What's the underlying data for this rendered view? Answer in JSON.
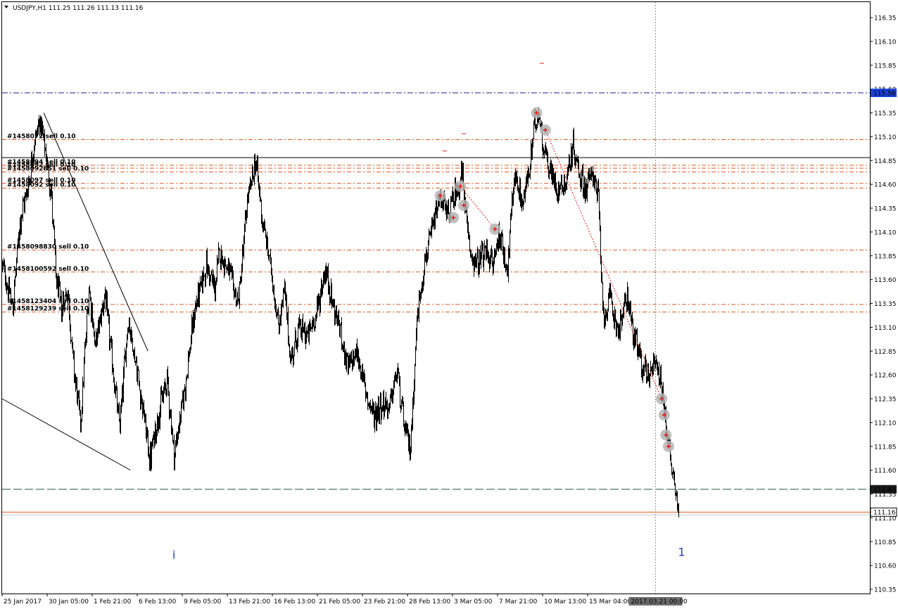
{
  "window": {
    "title": "USDJPY,H1  111.25 111.26 111.13 111.16",
    "menu_icon": "triangle-down-icon"
  },
  "colors": {
    "background": "#ffffff",
    "candles": "#000000",
    "order_line": "#e0561b",
    "resistance_line": "#1b1b8c",
    "support_line": "#1f5e3a",
    "bid_line": "#e0561b",
    "price_tag_blue": "#1a3fd6",
    "price_tag_dark": "#1a1a1a",
    "wave_label": "#1a3fd6",
    "marker_circle": "#b4b4b4",
    "trade_connect": "#e01b1b"
  },
  "chart_data": {
    "type": "candlestick",
    "symbol": "USDJPY",
    "timeframe": "H1",
    "ohlc_header": {
      "open": 111.25,
      "high": 111.26,
      "low": 111.13,
      "close": 111.16
    },
    "ylim": [
      110.3,
      116.45
    ],
    "y_ticks": [
      "116.35",
      "116.10",
      "115.85",
      "115.60",
      "115.35",
      "115.10",
      "114.85",
      "114.60",
      "114.35",
      "114.10",
      "113.85",
      "113.60",
      "113.35",
      "113.10",
      "112.85",
      "112.60",
      "112.35",
      "112.10",
      "111.85",
      "111.60",
      "111.35",
      "111.10",
      "110.85",
      "110.60",
      "110.35"
    ],
    "x_ticks": [
      "25 Jan 2017",
      "30 Jan 05:00",
      "1 Feb 21:00",
      "6 Feb 13:00",
      "9 Feb 05:00",
      "13 Feb 21:00",
      "16 Feb 13:00",
      "21 Feb 05:00",
      "23 Feb 21:00",
      "28 Feb 13:00",
      "3 Mar 05:00",
      "7 Mar 21:00",
      "10 Mar 13:00",
      "15 Mar 04:00"
    ],
    "cursor_time_label": "2017.03.21 00:00",
    "highlight_prices": [
      {
        "label": "115.56",
        "value": 115.56,
        "style": "resistance"
      },
      {
        "label": "111.40",
        "value": 111.4,
        "style": "support"
      },
      {
        "label": "111.16",
        "value": 111.16,
        "style": "bid"
      }
    ],
    "horizontal_line": 114.88,
    "orders": [
      {
        "label": "#145807",
        "suffix": "sell 0.10",
        "price": 115.07
      },
      {
        "label": "#14580",
        "suffix": "sell 0.10",
        "price": 114.8
      },
      {
        "label": "#145809",
        "suffix": "sell 0.10",
        "price": 114.77
      },
      {
        "label": "#145809",
        "suffix": "sell 0.10",
        "price": 114.73
      },
      {
        "label": "#14580",
        "suffix": "sell 0.10",
        "price": 114.61
      },
      {
        "label": "#145809",
        "suffix": "sell 0.10",
        "price": 114.56
      },
      {
        "label": "#145809",
        "suffix": "sell 0.10",
        "price": 113.91
      },
      {
        "label": "#145810",
        "suffix": "sell 0.10",
        "price": 113.68
      },
      {
        "label": "#145812",
        "suffix": "sell 0.10",
        "price": 113.34
      },
      {
        "label": "#145812",
        "suffix": "sell 0.10",
        "price": 113.26
      }
    ],
    "order_labels": [
      {
        "text": "#1458072",
        "suffix": "sell 0.10"
      },
      {
        "text": "#1458094",
        "suffix": "sell 0.10"
      },
      {
        "text": "#1458092",
        "suffix": "sell 0.10"
      },
      {
        "text": "#1458092851",
        "suffix": "sell 0.10"
      },
      {
        "text": "#1458097",
        "suffix": "sell 0.10"
      },
      {
        "text": "#1458092",
        "suffix": "sell 0.10"
      },
      {
        "text": "#1458098830",
        "suffix": "sell 0.10"
      },
      {
        "text": "#1458100592",
        "suffix": "sell 0.10"
      },
      {
        "text": "#1458123404",
        "suffix": "sell 0.10"
      },
      {
        "text": "#1458129239",
        "suffix": "sell 0.10"
      }
    ],
    "price_path": [
      [
        0,
        113.75
      ],
      [
        0.012,
        113.3
      ],
      [
        0.02,
        114.2
      ],
      [
        0.03,
        114.6
      ],
      [
        0.037,
        115.05
      ],
      [
        0.043,
        115.28
      ],
      [
        0.05,
        114.9
      ],
      [
        0.056,
        114.55
      ],
      [
        0.062,
        113.6
      ],
      [
        0.068,
        113.3
      ],
      [
        0.075,
        113.5
      ],
      [
        0.082,
        112.7
      ],
      [
        0.09,
        112.1
      ],
      [
        0.1,
        113.55
      ],
      [
        0.107,
        112.9
      ],
      [
        0.118,
        113.45
      ],
      [
        0.128,
        112.6
      ],
      [
        0.135,
        112.05
      ],
      [
        0.145,
        113.2
      ],
      [
        0.155,
        112.65
      ],
      [
        0.162,
        112.25
      ],
      [
        0.17,
        111.7
      ],
      [
        0.18,
        112.2
      ],
      [
        0.19,
        112.55
      ],
      [
        0.198,
        111.75
      ],
      [
        0.21,
        112.45
      ],
      [
        0.222,
        113.3
      ],
      [
        0.235,
        113.75
      ],
      [
        0.245,
        113.5
      ],
      [
        0.25,
        113.9
      ],
      [
        0.26,
        113.7
      ],
      [
        0.272,
        113.35
      ],
      [
        0.282,
        114.4
      ],
      [
        0.292,
        114.85
      ],
      [
        0.3,
        114.2
      ],
      [
        0.31,
        113.7
      ],
      [
        0.318,
        113.1
      ],
      [
        0.325,
        113.5
      ],
      [
        0.332,
        112.75
      ],
      [
        0.342,
        113.1
      ],
      [
        0.352,
        113.0
      ],
      [
        0.362,
        113.25
      ],
      [
        0.372,
        113.7
      ],
      [
        0.382,
        113.3
      ],
      [
        0.39,
        113.05
      ],
      [
        0.398,
        112.65
      ],
      [
        0.408,
        112.85
      ],
      [
        0.418,
        112.45
      ],
      [
        0.428,
        112.15
      ],
      [
        0.436,
        112.3
      ],
      [
        0.446,
        112.25
      ],
      [
        0.455,
        112.65
      ],
      [
        0.463,
        112.05
      ],
      [
        0.47,
        111.8
      ],
      [
        0.478,
        113.2
      ],
      [
        0.486,
        113.75
      ],
      [
        0.495,
        114.1
      ],
      [
        0.505,
        114.5
      ],
      [
        0.512,
        114.25
      ],
      [
        0.52,
        114.45
      ],
      [
        0.53,
        114.7
      ],
      [
        0.538,
        113.9
      ],
      [
        0.548,
        113.75
      ],
      [
        0.557,
        113.9
      ],
      [
        0.565,
        113.75
      ],
      [
        0.573,
        114.1
      ],
      [
        0.582,
        113.7
      ],
      [
        0.59,
        114.7
      ],
      [
        0.6,
        114.4
      ],
      [
        0.608,
        114.8
      ],
      [
        0.613,
        115.2
      ],
      [
        0.618,
        115.35
      ],
      [
        0.623,
        115.05
      ],
      [
        0.63,
        114.75
      ],
      [
        0.64,
        114.55
      ],
      [
        0.65,
        114.65
      ],
      [
        0.658,
        115.0
      ],
      [
        0.665,
        114.7
      ],
      [
        0.673,
        114.55
      ],
      [
        0.68,
        114.75
      ],
      [
        0.687,
        114.45
      ],
      [
        0.692,
        113.2
      ],
      [
        0.7,
        113.4
      ],
      [
        0.71,
        113.05
      ],
      [
        0.72,
        113.45
      ],
      [
        0.728,
        113.0
      ],
      [
        0.737,
        112.7
      ],
      [
        0.745,
        112.6
      ],
      [
        0.752,
        112.8
      ],
      [
        0.76,
        112.45
      ],
      [
        0.765,
        112.1
      ],
      [
        0.768,
        111.85
      ],
      [
        0.772,
        111.6
      ],
      [
        0.776,
        111.45
      ],
      [
        0.779,
        111.16
      ]
    ],
    "markers": [
      {
        "t": 0.505,
        "p": 114.48
      },
      {
        "t": 0.52,
        "p": 114.25
      },
      {
        "t": 0.528,
        "p": 114.58
      },
      {
        "t": 0.532,
        "p": 114.38
      },
      {
        "t": 0.568,
        "p": 114.13
      },
      {
        "t": 0.616,
        "p": 115.35
      },
      {
        "t": 0.626,
        "p": 115.17
      },
      {
        "t": 0.76,
        "p": 112.35
      },
      {
        "t": 0.763,
        "p": 112.18
      },
      {
        "t": 0.765,
        "p": 111.97
      },
      {
        "t": 0.768,
        "p": 111.85
      }
    ],
    "trade_links": [
      [
        [
          0.528,
          114.58
        ],
        [
          0.568,
          114.13
        ]
      ],
      [
        [
          0.626,
          115.17
        ],
        [
          0.76,
          112.35
        ]
      ]
    ],
    "trendlines": [
      [
        [
          0.048,
          115.35
        ],
        [
          0.168,
          112.85
        ]
      ],
      [
        [
          0.0,
          112.35
        ],
        [
          0.148,
          111.6
        ]
      ]
    ],
    "pending_ticks": [
      {
        "t": 0.622,
        "p": 115.87
      },
      {
        "t": 0.532,
        "p": 115.13
      },
      {
        "t": 0.51,
        "p": 114.95
      }
    ],
    "wave_labels": [
      {
        "text": "i",
        "t": 0.198,
        "p": 110.67
      },
      {
        "text": "1",
        "t": 0.783,
        "p": 110.7
      }
    ],
    "cursor_t": 0.753
  }
}
